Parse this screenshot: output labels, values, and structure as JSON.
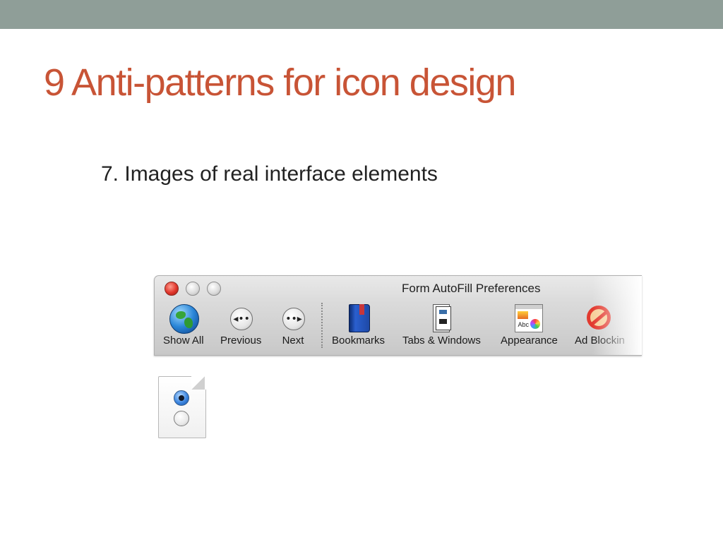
{
  "slide": {
    "title": "9 Anti-patterns for icon design",
    "bullet": "7. Images of real interface elements"
  },
  "window": {
    "title": "Form AutoFill Preferences",
    "toolbar": [
      {
        "label": "Show All",
        "icon": "globe-icon"
      },
      {
        "label": "Previous",
        "icon": "previous-arrow-icon"
      },
      {
        "label": "Next",
        "icon": "next-arrow-icon"
      },
      {
        "label": "Bookmarks",
        "icon": "bookmarks-book-icon"
      },
      {
        "label": "Tabs & Windows",
        "icon": "tabs-windows-icon"
      },
      {
        "label": "Appearance",
        "icon": "appearance-icon"
      },
      {
        "label": "Ad Blockin",
        "icon": "ad-blocking-icon"
      }
    ]
  },
  "colors": {
    "topbar": "#8f9e98",
    "title": "#c85436"
  }
}
